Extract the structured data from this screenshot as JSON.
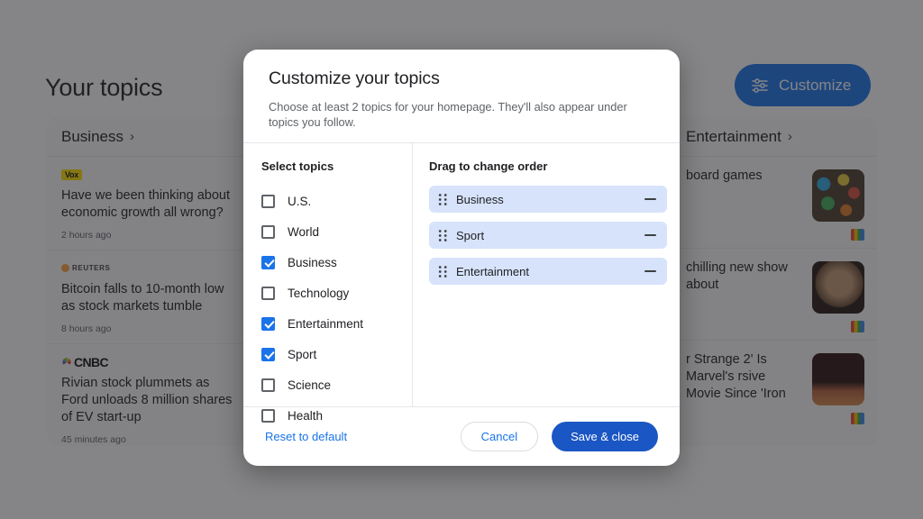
{
  "background": {
    "page_title": "Your topics",
    "customize_button": {
      "label": "Customize",
      "icon": "tune-icon",
      "color": "#1a73e8"
    },
    "back_arrow_icon": "arrow-left-icon",
    "cards": [
      {
        "title": "Business",
        "chevron": "›",
        "articles": [
          {
            "source": "Vox",
            "headline": "Have we been thinking about economic growth all wrong?",
            "time": "2 hours ago"
          },
          {
            "source": "REUTERS",
            "headline": "Bitcoin falls to 10-month low as stock markets tumble",
            "time": "8 hours ago"
          },
          {
            "source": "CNBC",
            "headline": "Rivian stock plummets as Ford unloads 8 million shares of EV start-up",
            "time": "45 minutes ago"
          }
        ]
      },
      {
        "title": "Entertainment",
        "chevron": "›",
        "articles": [
          {
            "headline": "board games"
          },
          {
            "headline": "chilling new show about"
          },
          {
            "headline": "r Strange 2' Is Marvel's rsive Movie Since 'Iron"
          }
        ]
      }
    ]
  },
  "dialog": {
    "title": "Customize your topics",
    "subtitle": "Choose at least 2 topics for your homepage. They'll also appear under topics you follow.",
    "select_topics_label": "Select topics",
    "drag_label": "Drag to change order",
    "topics": [
      {
        "label": "U.S.",
        "checked": false
      },
      {
        "label": "World",
        "checked": false
      },
      {
        "label": "Business",
        "checked": true
      },
      {
        "label": "Technology",
        "checked": false
      },
      {
        "label": "Entertainment",
        "checked": true
      },
      {
        "label": "Sport",
        "checked": true
      },
      {
        "label": "Science",
        "checked": false
      },
      {
        "label": "Health",
        "checked": false
      }
    ],
    "order": [
      {
        "label": "Business"
      },
      {
        "label": "Sport"
      },
      {
        "label": "Entertainment"
      }
    ],
    "footer": {
      "reset_label": "Reset to default",
      "cancel_label": "Cancel",
      "save_label": "Save & close"
    },
    "accent_color": "#1a73e8",
    "save_button_color": "#1a56c4",
    "drag_pill_color": "#d7e3fb"
  }
}
